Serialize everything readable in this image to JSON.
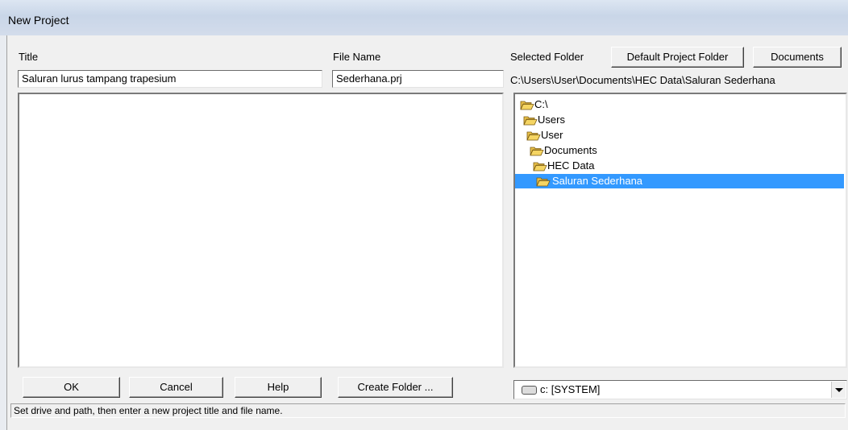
{
  "window": {
    "title": "New Project"
  },
  "form": {
    "title_label": "Title",
    "title_value": "Saluran lurus tampang trapesium",
    "filename_label": "File Name",
    "filename_value": "Sederhana.prj",
    "selected_folder_label": "Selected Folder",
    "selected_folder_path": "C:\\Users\\User\\Documents\\HEC Data\\Saluran Sederhana"
  },
  "buttons": {
    "default_project_folder": "Default Project Folder",
    "documents": "Documents",
    "ok": "OK",
    "cancel": "Cancel",
    "help": "Help",
    "create_folder": "Create Folder ..."
  },
  "folder_tree": {
    "items": [
      {
        "label": "C:\\",
        "icon": "open-folder-icon"
      },
      {
        "label": "Users",
        "icon": "open-folder-icon"
      },
      {
        "label": "User",
        "icon": "open-folder-icon"
      },
      {
        "label": "Documents",
        "icon": "open-folder-icon"
      },
      {
        "label": "HEC Data",
        "icon": "open-folder-icon"
      },
      {
        "label": "Saluran Sederhana",
        "icon": "open-folder-icon",
        "selected": true
      }
    ]
  },
  "drive_select": {
    "value": "c: [SYSTEM]",
    "icon": "drive-icon"
  },
  "status_bar": {
    "text": "Set drive and path, then enter a new project title and file name."
  },
  "colors": {
    "selection": "#3399ff",
    "folder": "#f5d563"
  }
}
